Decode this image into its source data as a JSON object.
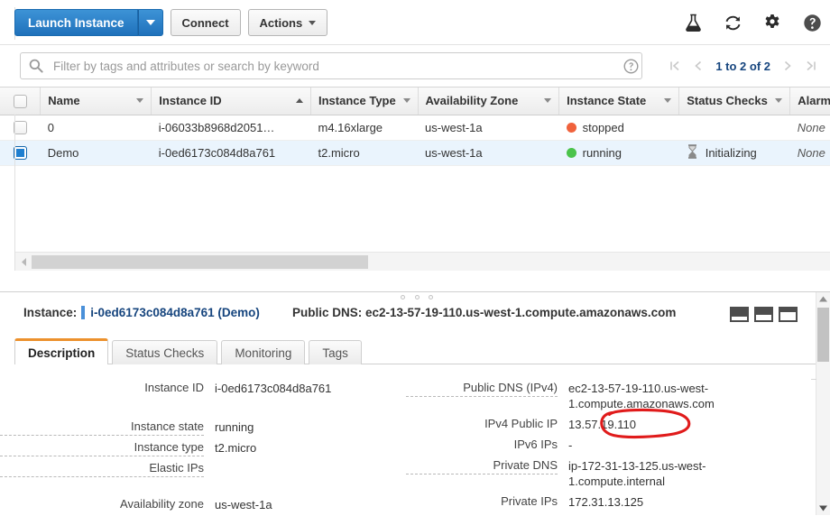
{
  "toolbar": {
    "launch_label": "Launch Instance",
    "launch_caret_icon": "caret-down-icon",
    "connect_label": "Connect",
    "actions_label": "Actions",
    "icons": [
      {
        "name": "flask-icon",
        "title": "Beta features"
      },
      {
        "name": "refresh-icon",
        "title": "Refresh"
      },
      {
        "name": "gear-icon",
        "title": "Settings"
      },
      {
        "name": "help-icon",
        "title": "Help"
      }
    ],
    "primary_color": "#1f71bb"
  },
  "filter": {
    "placeholder": "Filter by tags and attributes or search by keyword",
    "value": "",
    "search_icon": "search-icon",
    "help_icon": "help-circle-icon"
  },
  "pager": {
    "first_icon": "page-first-icon",
    "prev_icon": "page-prev-icon",
    "label": "1 to 2 of 2",
    "next_icon": "page-next-icon",
    "last_icon": "page-last-icon"
  },
  "table": {
    "columns": [
      {
        "label": "Name",
        "sort": "menu"
      },
      {
        "label": "Instance ID",
        "sort": "asc"
      },
      {
        "label": "Instance Type",
        "sort": "menu"
      },
      {
        "label": "Availability Zone",
        "sort": "menu"
      },
      {
        "label": "Instance State",
        "sort": "menu"
      },
      {
        "label": "Status Checks",
        "sort": "menu"
      },
      {
        "label": "Alarm Status",
        "sort": "none"
      }
    ],
    "rows": [
      {
        "selected": false,
        "name": "0",
        "instance_id": "i-06033b8968d2051…",
        "instance_type": "m4.16xlarge",
        "availability_zone": "us-west-1a",
        "state": "stopped",
        "state_color": "#f0623c",
        "status_checks": "",
        "status_icon": "",
        "alarm_status": "None"
      },
      {
        "selected": true,
        "name": "Demo",
        "instance_id": "i-0ed6173c084d8a761",
        "instance_type": "t2.micro",
        "availability_zone": "us-west-1a",
        "state": "running",
        "state_color": "#4bc34b",
        "status_checks": "Initializing",
        "status_icon": "hourglass-icon",
        "alarm_status": "None"
      }
    ]
  },
  "detail": {
    "instance_prefix": "Instance:",
    "instance_id": "i-0ed6173c084d8a761 (Demo)",
    "public_dns_header": "Public DNS: ec2-13-57-19-110.us-west-1.compute.amazonaws.com",
    "tabs": [
      {
        "label": "Description",
        "active": true
      },
      {
        "label": "Status Checks",
        "active": false
      },
      {
        "label": "Monitoring",
        "active": false
      },
      {
        "label": "Tags",
        "active": false
      }
    ],
    "active_tab_color": "#ec912d",
    "left_fields": [
      {
        "label": "Instance ID",
        "value": "i-0ed6173c084d8a761",
        "dashed": false,
        "gap": ""
      },
      {
        "label": "Instance state",
        "value": "running",
        "dashed": true,
        "gap": "gap"
      },
      {
        "label": "Instance type",
        "value": "t2.micro",
        "dashed": true,
        "gap": ""
      },
      {
        "label": "Elastic IPs",
        "value": "",
        "dashed": true,
        "gap": ""
      },
      {
        "label": "Availability zone",
        "value": "us-west-1a",
        "dashed": false,
        "gap": "gap2"
      }
    ],
    "right_fields": [
      {
        "label": "Public DNS (IPv4)",
        "value": "ec2-13-57-19-110.us-west-1.compute.amazonaws.com",
        "dashed": true,
        "gap": ""
      },
      {
        "label": "IPv4 Public IP",
        "value": "13.57.19.110",
        "dashed": false,
        "gap": ""
      },
      {
        "label": "IPv6 IPs",
        "value": "-",
        "dashed": false,
        "gap": ""
      },
      {
        "label": "Private DNS",
        "value": "ip-172-31-13-125.us-west-1.compute.internal",
        "dashed": true,
        "gap": ""
      },
      {
        "label": "Private IPs",
        "value": "172.31.13.125",
        "dashed": false,
        "gap": ""
      }
    ],
    "panel_size_icons": [
      {
        "name": "panel-size-small-icon"
      },
      {
        "name": "panel-size-medium-icon"
      },
      {
        "name": "panel-size-large-icon"
      }
    ]
  },
  "annotation": {
    "type": "hand-drawn-ellipse",
    "target": "13.57.19.110",
    "color": "#e01b1b"
  }
}
